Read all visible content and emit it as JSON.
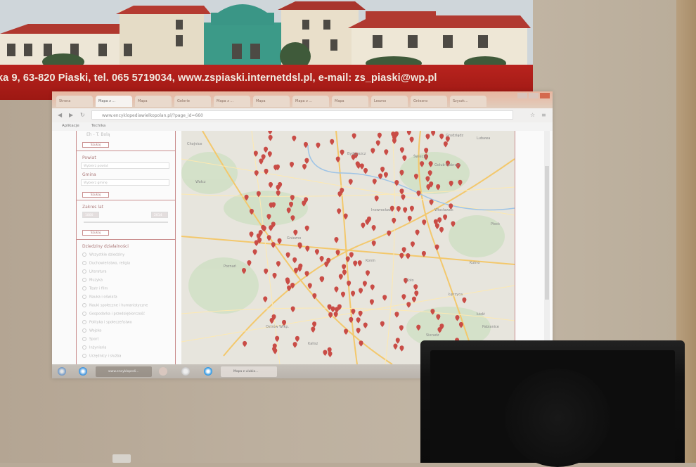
{
  "banner": {
    "text": "ka 9, 63-820 Piaski, tel. 065 5719034, www.zspiaski.internetdsl.pl,  e-mail: zs_piaski@wp.pl"
  },
  "browser": {
    "tabs": [
      "Strona",
      "Mapa z ...",
      "Mapa",
      "Gelerie",
      "Mapa z ...",
      "Mapa",
      "Mapa z ...",
      "Mapa",
      "Leszno",
      "Gniezno",
      "Szyszk...",
      "Gaszew",
      "Szlakow"
    ],
    "url": "www.encyklopediawielkopolan.pl/?page_id=660",
    "bookmarks": [
      "Aplikacje",
      "Techika"
    ]
  },
  "sidebar": {
    "top_label": "Eh - T. Bolą",
    "search_button": "Szukaj",
    "powiat_label": "Powiat",
    "powiat_value": "Wybierz powiat",
    "gmina_label": "Gmina",
    "gmina_value": "Wybierz gminę",
    "search_button_2": "Szukaj",
    "years_label": "Zakres lat",
    "year_from": "1800",
    "year_to": "2014",
    "search_button_3": "Szukaj",
    "categories_label": "Dziedziny działalności",
    "categories": [
      "Wszystkie dziedziny",
      "Duchowieństwo, religia",
      "Literatura",
      "Muzyka",
      "Teatr i film",
      "Nauka i oświata",
      "Nauki społeczne i humanistyczne",
      "Gospodarka i przedsiębiorczość",
      "Polityka i społeczeństwo",
      "Wojsko",
      "Sport",
      "Inżynieria",
      "Urzędnicy i służba"
    ],
    "search_button_4": "Szukaj"
  },
  "map": {
    "labels": [
      "Bydgoszcz",
      "Inowrocław",
      "Włocławek",
      "Płock",
      "Kutno",
      "Łódź",
      "Sieradz",
      "Kalisz",
      "Konin",
      "Gniezno",
      "Poznań",
      "Wałcz",
      "Chojnice",
      "Świecie",
      "Golub-Dobrzyń",
      "Lubawa",
      "Koło",
      "Łęczyca",
      "Pabianice",
      "Ostrów Wlkp.",
      "Grudziądz"
    ],
    "pin_color": "#c94c46"
  },
  "taskbar": {
    "items": [
      "Start",
      "Internet Explorer",
      "www.encyklopedi...",
      "Media Player",
      "Chrome",
      "Skype",
      "Mapa z ulubio..."
    ]
  },
  "colors": {
    "banner_red": "#b8231e",
    "wall": "#bdb09f",
    "speaker": "#111111",
    "sidebar_border": "#c98e8e"
  }
}
